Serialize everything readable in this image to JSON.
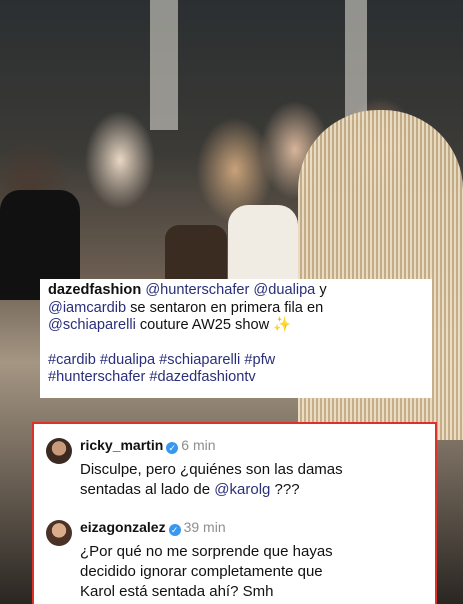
{
  "post": {
    "caption": {
      "username": "dazedfashion",
      "line1_mentions": "@hunterschafer @dualipa",
      "line1_tail": " y",
      "line2_mention": "@iamcardib",
      "line2_tail": " se sentaron en primera fila en",
      "line3_mention": "@schiaparelli",
      "line3_tail": " couture AW25 show",
      "line3_emoji": "✨",
      "hashtags_line1": "#cardib #dualipa #schiaparelli #pfw",
      "hashtags_line2": "#hunterschafer #dazedfashiontv"
    }
  },
  "comments": [
    {
      "username": "ricky_martin",
      "verified_glyph": "✓",
      "time": "6 min",
      "text_line1": "Disculpe, pero ¿quiénes son las damas",
      "text_line2": "sentadas al lado de ",
      "mention": "@karolg",
      "text_tail": " ???"
    },
    {
      "username": "eizagonzalez",
      "verified_glyph": "✓",
      "time": "39 min",
      "text_line1": "¿Por qué no me sorprende que hayas",
      "text_line2": "decidido ignorar completamente que",
      "text_line3": "Karol está sentada ahí? Smh"
    }
  ],
  "colors": {
    "mention": "#2b2f7a",
    "verified": "#3897f0",
    "highlight_border": "#e0302a"
  }
}
